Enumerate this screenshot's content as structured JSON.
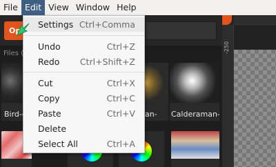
{
  "menubar": {
    "items": [
      {
        "label": "File",
        "active": false
      },
      {
        "label": "Edit",
        "active": true
      },
      {
        "label": "View",
        "active": false
      },
      {
        "label": "Window",
        "active": false
      },
      {
        "label": "Help",
        "active": false
      }
    ]
  },
  "toolbar": {
    "open_label": "Op"
  },
  "files": {
    "title": "Files (",
    "thumbnails": [
      {
        "label": "Bird-c"
      },
      {
        "label": ""
      },
      {
        "label": "an-"
      },
      {
        "label": "Calderaman-"
      }
    ]
  },
  "ruler": {
    "label": "-250"
  },
  "edit_menu": {
    "items": [
      {
        "label": "Settings",
        "shortcut": "Ctrl+Comma"
      },
      {
        "label": "Undo",
        "shortcut": "Ctrl+Z"
      },
      {
        "label": "Redo",
        "shortcut": "Ctrl+Shift+Z"
      },
      {
        "label": "Cut",
        "shortcut": "Ctrl+X"
      },
      {
        "label": "Copy",
        "shortcut": "Ctrl+C"
      },
      {
        "label": "Paste",
        "shortcut": "Ctrl+V"
      },
      {
        "label": "Delete",
        "shortcut": ""
      },
      {
        "label": "Select All",
        "shortcut": "Ctrl+A"
      }
    ]
  },
  "colors": {
    "accent": "#e2541c",
    "menu_active": "#3f5f85",
    "cursor": "#2ecc71"
  }
}
